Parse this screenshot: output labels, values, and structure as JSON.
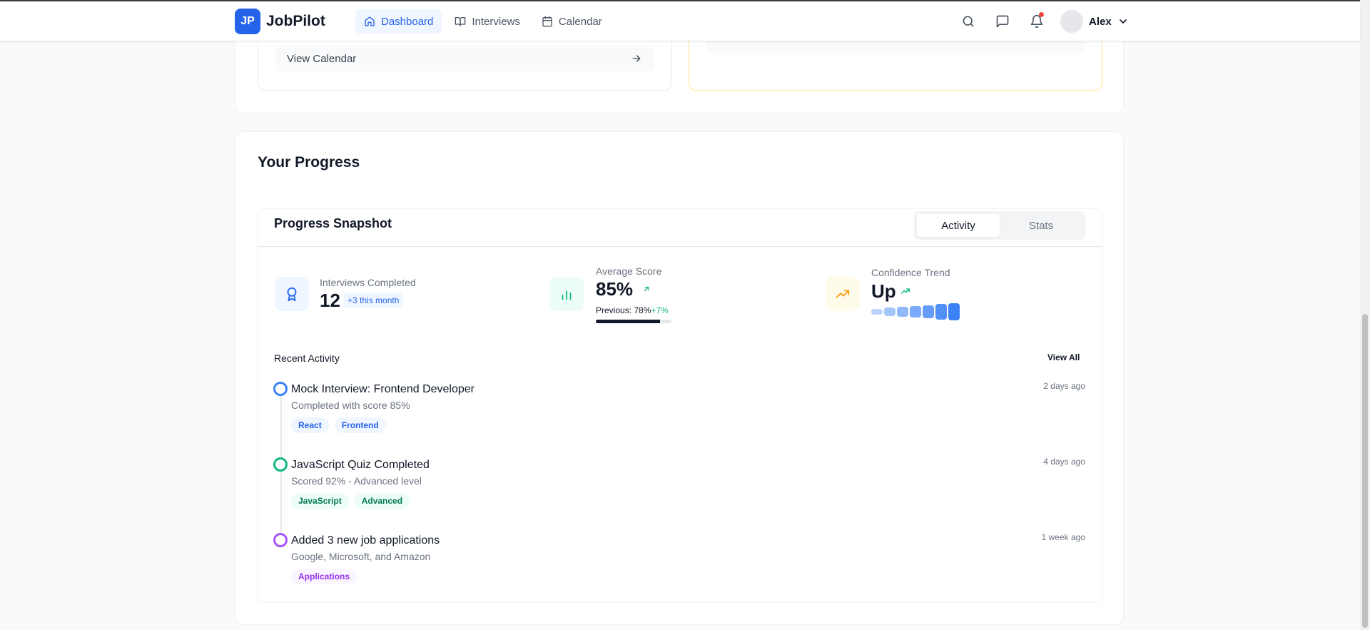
{
  "app": {
    "brand_initials": "JP",
    "brand_name": "JobPilot"
  },
  "nav": {
    "items": [
      {
        "label": "Dashboard",
        "icon": "home-icon",
        "active": true
      },
      {
        "label": "Interviews",
        "icon": "book-icon",
        "active": false
      },
      {
        "label": "Calendar",
        "icon": "calendar-icon",
        "active": false
      }
    ]
  },
  "header_actions": {
    "user_name": "Alex",
    "has_notification": true
  },
  "top_section": {
    "view_calendar_label": "View Calendar"
  },
  "progress": {
    "section_title": "Your Progress",
    "snapshot_title": "Progress Snapshot",
    "tabs": [
      {
        "label": "Activity",
        "active": true
      },
      {
        "label": "Stats",
        "active": false
      }
    ],
    "stats": {
      "interviews": {
        "label": "Interviews Completed",
        "value": "12",
        "badge": "+3 this month"
      },
      "average": {
        "label": "Average Score",
        "value": "85%",
        "previous": "Previous: 78%",
        "delta": "+7%",
        "progress_fraction": 0.85
      },
      "confidence": {
        "label": "Confidence Trend",
        "value": "Up",
        "trend_levels": [
          1,
          2,
          3,
          4,
          5,
          6,
          7
        ]
      }
    },
    "recent_activity_label": "Recent Activity",
    "view_all_label": "View All",
    "activities": [
      {
        "title": "Mock Interview: Frontend Developer",
        "subtitle": "Completed with score 85%",
        "time": "2 days ago",
        "color": "#3b82f6",
        "tags": [
          "React",
          "Frontend"
        ]
      },
      {
        "title": "JavaScript Quiz Completed",
        "subtitle": "Scored 92% - Advanced level",
        "time": "4 days ago",
        "color": "#10b981",
        "tags": [
          "JavaScript",
          "Advanced"
        ]
      },
      {
        "title": "Added 3 new job applications",
        "subtitle": "Google, Microsoft, and Amazon",
        "time": "1 week ago",
        "color": "#a855f7",
        "tags": [
          "Applications"
        ]
      }
    ]
  },
  "colors": {
    "accent": "#2563eb",
    "success": "#10b981",
    "warning": "#f59e0b",
    "purple": "#a855f7"
  }
}
